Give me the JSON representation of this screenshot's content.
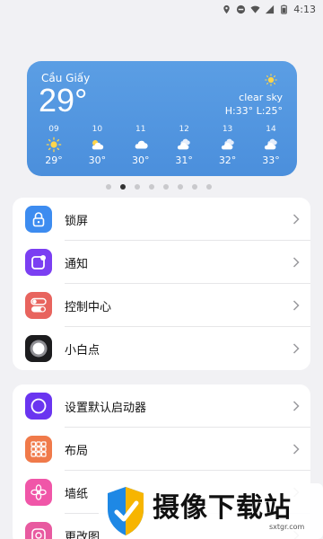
{
  "status_bar": {
    "time": "4:13"
  },
  "weather": {
    "city": "Cầu Giấy",
    "temperature": "29°",
    "condition": "clear sky",
    "high_low": "H:33° L:25°",
    "forecast": [
      {
        "hour": "09",
        "icon": "sun-icon",
        "temp": "29°"
      },
      {
        "hour": "10",
        "icon": "partly-cloudy-icon",
        "temp": "30°"
      },
      {
        "hour": "11",
        "icon": "cloud-icon",
        "temp": "30°"
      },
      {
        "hour": "12",
        "icon": "cloudy-icon",
        "temp": "31°"
      },
      {
        "hour": "13",
        "icon": "cloudy-icon",
        "temp": "32°"
      },
      {
        "hour": "14",
        "icon": "cloudy-icon",
        "temp": "33°"
      }
    ]
  },
  "page_indicator": {
    "count": 8,
    "active": 2
  },
  "settings_group_1": [
    {
      "label": "锁屏",
      "icon": "lock-screen-icon",
      "color": "#3d8cf0"
    },
    {
      "label": "通知",
      "icon": "notification-icon",
      "color": "#7b3ff2"
    },
    {
      "label": "控制中心",
      "icon": "control-center-icon",
      "color": "#e8645e"
    },
    {
      "label": "小白点",
      "icon": "assistive-touch-icon",
      "color": "#1c1c1e"
    }
  ],
  "settings_group_2": [
    {
      "label": "设置默认启动器",
      "icon": "default-launcher-icon",
      "color": "#6a35f0"
    },
    {
      "label": "布局",
      "icon": "layout-icon",
      "color": "#f07a4a"
    },
    {
      "label": "墙纸",
      "icon": "wallpaper-icon",
      "color": "#f056a8"
    },
    {
      "label": "更改图",
      "icon": "change-icon-icon",
      "color": "#e85aa0"
    }
  ],
  "watermark": {
    "title": "摄像下载站",
    "url": "sxtgr.com"
  },
  "colors": {
    "background": "#f1f1f4",
    "widget": "#4f93df",
    "text": "#111111"
  }
}
